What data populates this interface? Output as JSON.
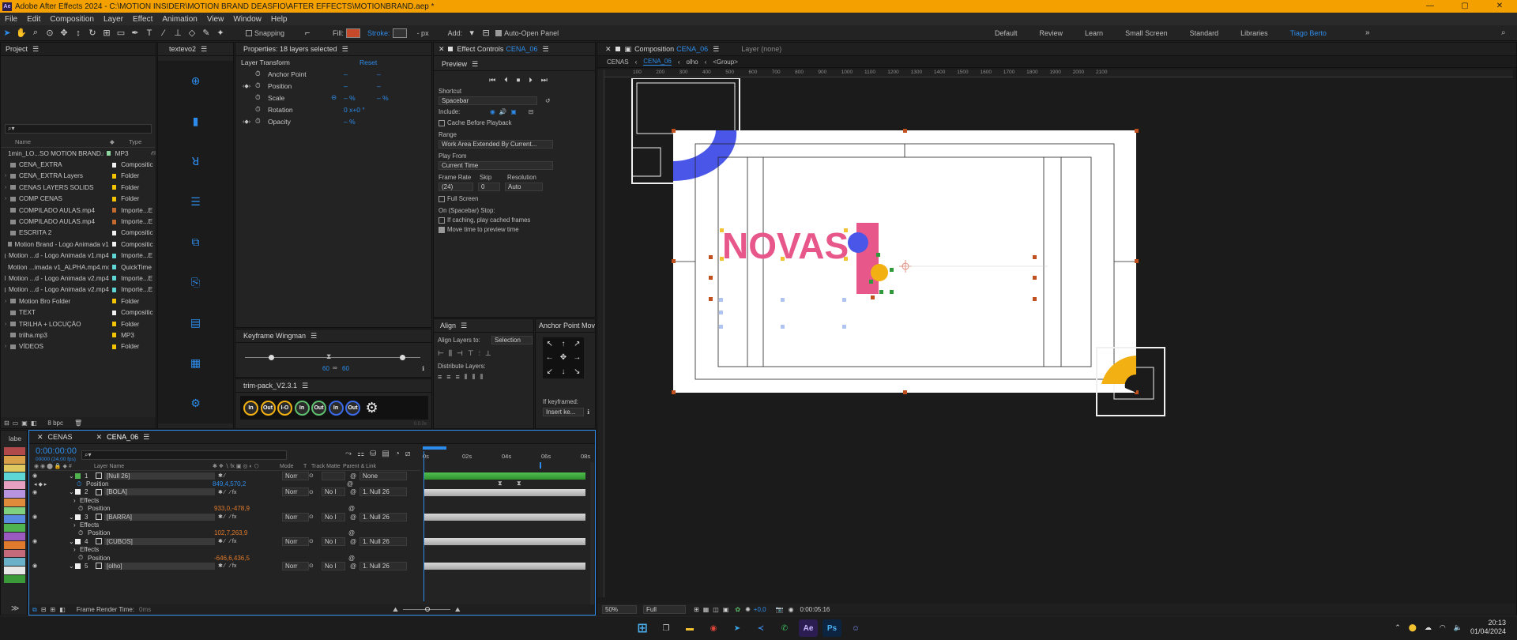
{
  "window": {
    "title": "Adobe After Effects 2024 - C:\\MOTION INSIDER\\MOTION BRAND DEASFIO\\AFTER EFFECTS\\MOTIONBRAND.aep *"
  },
  "menu": [
    "File",
    "Edit",
    "Composition",
    "Layer",
    "Effect",
    "Animation",
    "View",
    "Window",
    "Help"
  ],
  "toolbar": {
    "snapping": "Snapping",
    "fill": "Fill:",
    "stroke": "Stroke:",
    "stroke_px": "- px",
    "add": "Add:",
    "auto_open": "Auto-Open Panel"
  },
  "workspaces": [
    "Default",
    "Review",
    "Learn",
    "Small Screen",
    "Standard",
    "Libraries",
    "Tiago Berto"
  ],
  "project": {
    "tab": "Project",
    "search_placeholder": "",
    "col_name": "Name",
    "col_type": "Type",
    "items": [
      {
        "name": "1min_LO...SO MOTION BRAND.mp3",
        "type": "MP3",
        "color": "#8fd6a0"
      },
      {
        "name": "CENA_EXTRA",
        "type": "Compositic",
        "color": "#f0f0f0"
      },
      {
        "name": "CENA_EXTRA Layers",
        "type": "Folder",
        "color": "#f5c400"
      },
      {
        "name": "CENAS LAYERS SOLIDS",
        "type": "Folder",
        "color": "#f5c400"
      },
      {
        "name": "COMP CENAS",
        "type": "Folder",
        "color": "#f5c400"
      },
      {
        "name": "COMPILADO AULAS.mp4",
        "type": "Importe...E",
        "color": "#c46a2e"
      },
      {
        "name": "COMPILADO AULAS.mp4",
        "type": "Importe...E",
        "color": "#c46a2e"
      },
      {
        "name": "ESCRITA 2",
        "type": "Compositic",
        "color": "#f0f0f0"
      },
      {
        "name": "Motion Brand - Logo Animada v1",
        "type": "Compositic",
        "color": "#f0f0f0"
      },
      {
        "name": "Motion ...d - Logo Animada v1.mp4",
        "type": "Importe...E",
        "color": "#5ed6d6"
      },
      {
        "name": "Motion ...imada v1_ALPHA.mp4.mov",
        "type": "QuickTime",
        "color": "#5ed6d6"
      },
      {
        "name": "Motion ...d - Logo Animada v2.mp4",
        "type": "Importe...E",
        "color": "#5ed6d6"
      },
      {
        "name": "Motion ...d - Logo Animada v2.mp4",
        "type": "Importe...E",
        "color": "#5ed6d6"
      },
      {
        "name": "Motion Bro Folder",
        "type": "Folder",
        "color": "#f5c400"
      },
      {
        "name": "TEXT",
        "type": "Compositic",
        "color": "#f0f0f0"
      },
      {
        "name": "TRILHA + LOCUÇÃO",
        "type": "Folder",
        "color": "#f5c400"
      },
      {
        "name": "trilha.mp3",
        "type": "MP3",
        "color": "#f5c400"
      },
      {
        "name": "VÍDEOS",
        "type": "Folder",
        "color": "#f5c400"
      }
    ],
    "bpc": "8 bpc"
  },
  "textevo": {
    "tab": "textevo2"
  },
  "properties": {
    "tab": "Properties: 18 layers selected",
    "section": "Layer Transform",
    "reset": "Reset",
    "rows": [
      {
        "label": "Anchor Point",
        "v1": "–",
        "v2": "–"
      },
      {
        "label": "Position",
        "v1": "–",
        "v2": "–"
      },
      {
        "label": "Scale",
        "v1": "– %",
        "v2": "– %"
      },
      {
        "label": "Rotation",
        "v1": "0 x+0 °",
        "v2": ""
      },
      {
        "label": "Opacity",
        "v1": "– %",
        "v2": ""
      }
    ]
  },
  "keyframe": {
    "tab": "Keyframe Wingman",
    "v1": "60",
    "v2": "60"
  },
  "trim": {
    "tab": "trim-pack_V2.3.1",
    "buttons": [
      "In",
      "Out",
      "I-O",
      "In",
      "Out",
      "In",
      "Out"
    ],
    "version": "0.0.0x"
  },
  "effect": {
    "tab": "Effect Controls",
    "comp": "CENA_06"
  },
  "preview": {
    "tab": "Preview",
    "shortcut_label": "Shortcut",
    "shortcut": "Spacebar",
    "include": "Include:",
    "cache": "Cache Before Playback",
    "range_label": "Range",
    "range": "Work Area Extended By Current...",
    "playfrom_label": "Play From",
    "playfrom": "Current Time",
    "fr_label": "Frame Rate",
    "skip_label": "Skip",
    "res_label": "Resolution",
    "fr": "(24)",
    "skip": "0",
    "res": "Auto",
    "fullscreen": "Full Screen",
    "stop_label": "On (Spacebar) Stop:",
    "stop1": "If caching, play cached frames",
    "stop2": "Move time to preview time"
  },
  "align": {
    "tab": "Align",
    "layers_to": "Align Layers to:",
    "selection": "Selection",
    "distribute": "Distribute Layers:"
  },
  "anchor": {
    "tab": "Anchor Point Mov",
    "if_keyframed": "If keyframed:",
    "insert": "Insert ke..."
  },
  "composition": {
    "tab": "Composition",
    "comp": "CENA_06",
    "layer_tab": "Layer (none)",
    "breadcrumbs": [
      "CENAS",
      "CENA_06",
      "olho",
      "<Group>"
    ],
    "ruler": [
      "100",
      "200",
      "300",
      "400",
      "500",
      "600",
      "700",
      "800",
      "900",
      "1000",
      "1100",
      "1200",
      "1300",
      "1400",
      "1500",
      "1600",
      "1700",
      "1800",
      "1900",
      "2000",
      "2100"
    ],
    "text": "NOVAS",
    "zoom": "50%",
    "quality": "Full",
    "exposure": "+0,0",
    "timecode": "0:00:05:16"
  },
  "timeline": {
    "labe": "labe",
    "tabs": [
      "CENAS",
      "CENA_06"
    ],
    "time": "0:00:00:00",
    "fps": "00000 (24.00 fps)",
    "cols": {
      "layer": "Layer Name",
      "mode": "Mode",
      "t": "T",
      "track": "Track Matte",
      "parent": "Parent & Link"
    },
    "ruler": [
      "0s",
      "02s",
      "04s",
      "06s",
      "08s"
    ],
    "rows": [
      {
        "kind": "layer",
        "num": "1",
        "name": "[Null 26]",
        "mode": "Norr",
        "track": "",
        "parent": "None",
        "color": "#4fb34f"
      },
      {
        "kind": "prop",
        "name": "Position",
        "value": "849,4,570,2",
        "vclass": "blue"
      },
      {
        "kind": "layer",
        "num": "2",
        "name": "[BOLA]",
        "mode": "Norr",
        "track": "No I",
        "parent": "1. Null 26",
        "color": "#f0f0f0"
      },
      {
        "kind": "sub",
        "name": "Effects"
      },
      {
        "kind": "prop",
        "name": "Position",
        "value": "933,0,-478,9",
        "vclass": "orange"
      },
      {
        "kind": "layer",
        "num": "3",
        "name": "[BARRA]",
        "mode": "Norr",
        "track": "No I",
        "parent": "1. Null 26",
        "color": "#f0f0f0"
      },
      {
        "kind": "sub",
        "name": "Effects"
      },
      {
        "kind": "prop",
        "name": "Position",
        "value": "102,7,263,9",
        "vclass": "orange"
      },
      {
        "kind": "layer",
        "num": "4",
        "name": "[CUBOS]",
        "mode": "Norr",
        "track": "No I",
        "parent": "1. Null 26",
        "color": "#f0f0f0"
      },
      {
        "kind": "sub",
        "name": "Effects"
      },
      {
        "kind": "prop",
        "name": "Position",
        "value": "-646,6,436,5",
        "vclass": "orange"
      },
      {
        "kind": "layer",
        "num": "5",
        "name": "[olho]",
        "mode": "Norr",
        "track": "No I",
        "parent": "1. Null 26",
        "color": "#f0f0f0"
      }
    ],
    "render_time": "Frame Render Time:",
    "render_val": "0ms"
  },
  "taskbar": {
    "time": "20:13",
    "date": "01/04/2024"
  },
  "label_colors": [
    "#b04a4a",
    "#d9a04a",
    "#e0c860",
    "#5ed6d6",
    "#e8a0c0",
    "#b894e0",
    "#e08a3c",
    "#7fd17f",
    "#5a8ae0",
    "#4fb34f",
    "#9a5ac0",
    "#e07a2c",
    "#c46a7a",
    "#6ab0c8",
    "#e8e8e8",
    "#3a9a3a"
  ]
}
